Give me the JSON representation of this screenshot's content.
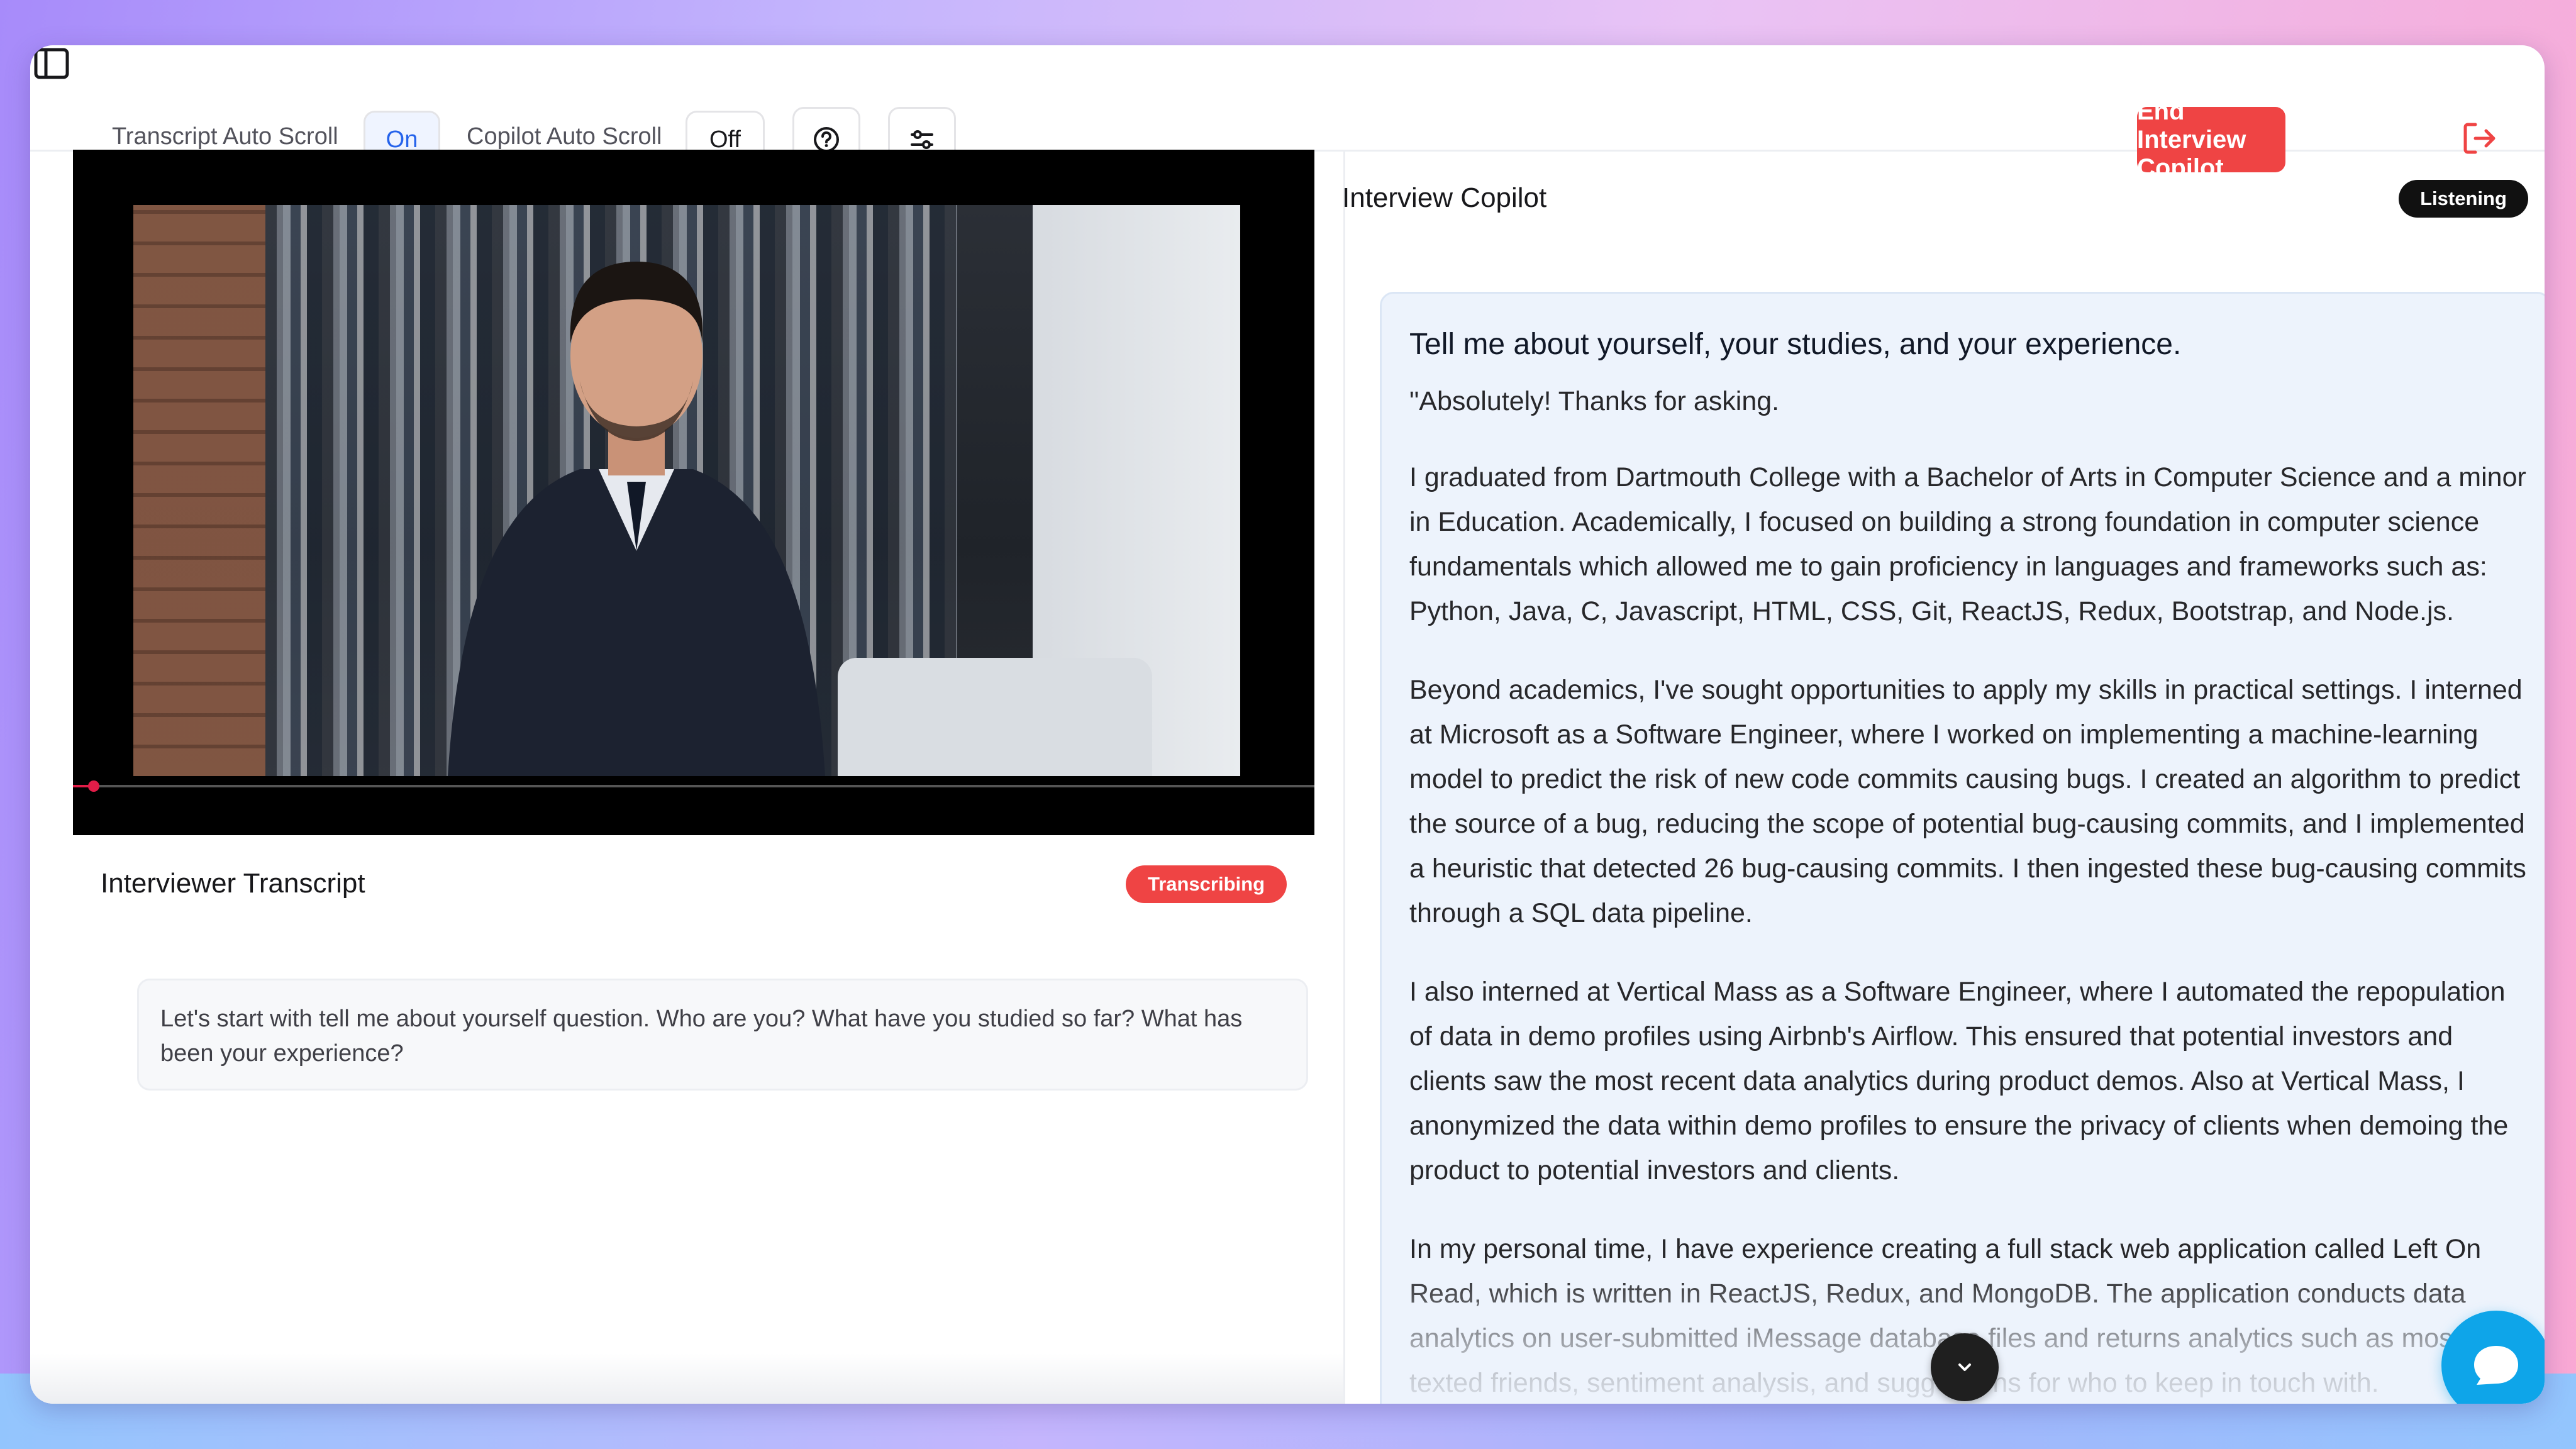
{
  "toolbar": {
    "transcript_auto_scroll_label": "Transcript Auto Scroll",
    "transcript_auto_scroll_value": "On",
    "copilot_auto_scroll_label": "Copilot Auto Scroll",
    "copilot_auto_scroll_value": "Off",
    "end_button_label": "End Interview Copilot",
    "icons": [
      "sidebar-toggle-icon",
      "help-circle-icon",
      "settings-sliders-icon",
      "logout-icon"
    ]
  },
  "transcript": {
    "title": "Interviewer Transcript",
    "status": "Transcribing",
    "text": "Let's start with tell me about yourself question. Who are you? What have you studied so far? What has been your experience?"
  },
  "copilot": {
    "title": "Interview Copilot",
    "status": "Listening",
    "question": "Tell me about yourself, your studies, and your experience.",
    "paragraphs": [
      "\"Absolutely! Thanks for asking.",
      "I graduated from Dartmouth College with a Bachelor of Arts in Computer Science and a minor in Education. Academically, I focused on building a strong foundation in computer science fundamentals which allowed me to gain proficiency in languages and frameworks such as: Python, Java, C, Javascript, HTML, CSS, Git, ReactJS, Redux, Bootstrap, and Node.js.",
      "Beyond academics, I've sought opportunities to apply my skills in practical settings. I interned at Microsoft as a Software Engineer, where I worked on implementing a machine-learning model to predict the risk of new code commits causing bugs. I created an algorithm to predict the source of a bug, reducing the scope of potential bug-causing commits, and I implemented a heuristic that detected 26 bug-causing commits. I then ingested these bug-causing commits through a SQL data pipeline.",
      "I also interned at Vertical Mass as a Software Engineer, where I automated the repopulation of data in demo profiles using Airbnb's Airflow. This ensured that potential investors and clients saw the most recent data analytics during product demos. Also at Vertical Mass, I anonymized the data within demo profiles to ensure the privacy of clients when demoing the product to potential investors and clients.",
      "In my personal time, I have experience creating a full stack web application called Left On Read, which is written in ReactJS, Redux, and MongoDB. The application conducts data analytics on user-submitted iMessage database files and returns analytics such as most texted friends, sentiment analysis, and suggestions for who to keep in touch with."
    ]
  },
  "colors": {
    "danger": "#ef4444",
    "accent_blue": "#2563eb",
    "chat_blue": "#0ea5e9",
    "card_bg": "#edf3fc"
  }
}
